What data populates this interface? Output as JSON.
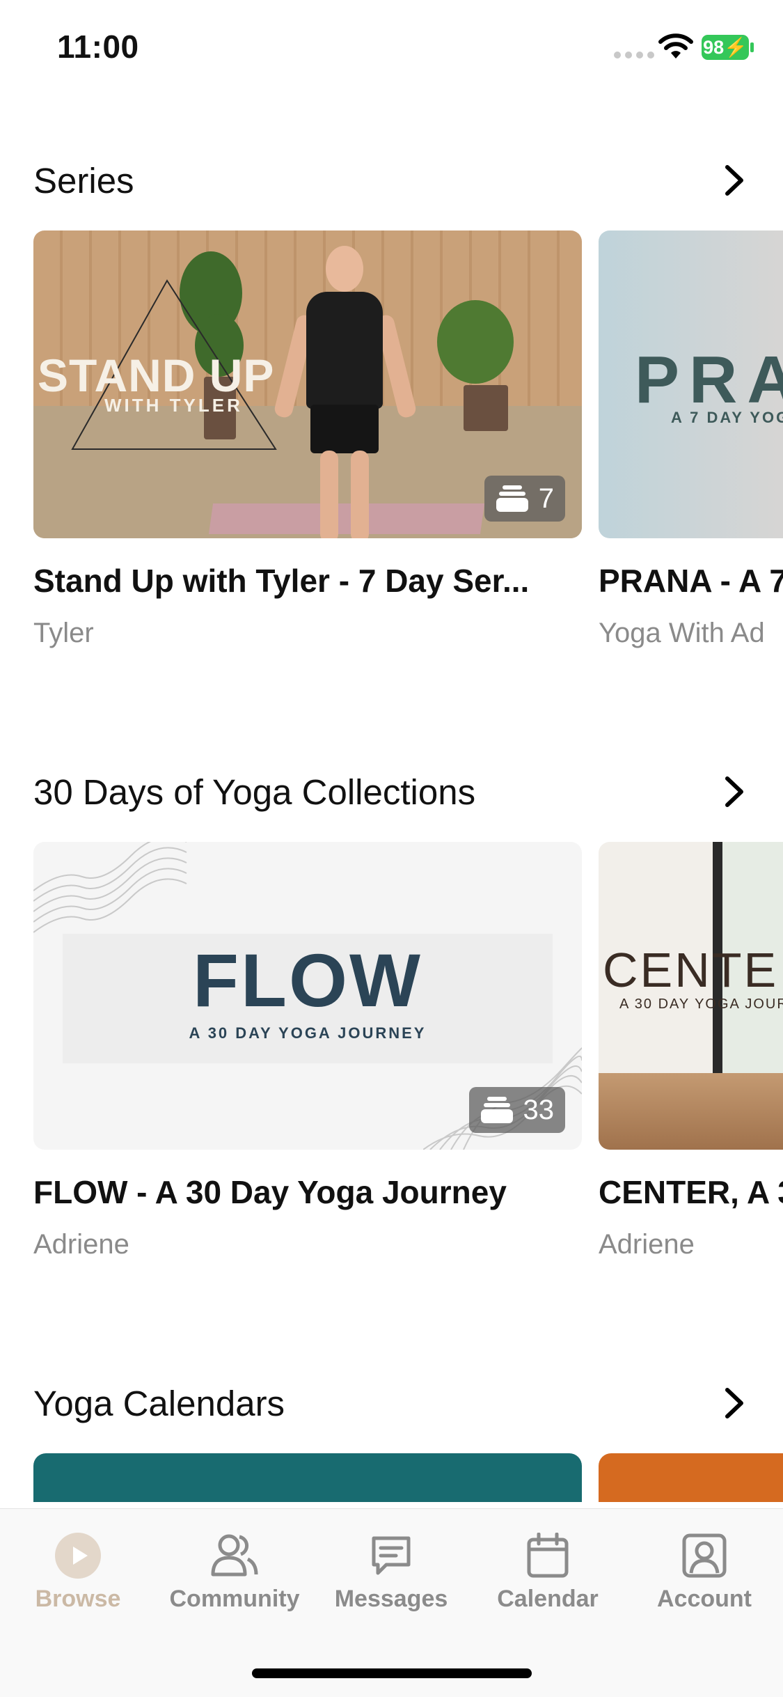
{
  "status_bar": {
    "time": "11:00",
    "battery": "98"
  },
  "sections": [
    {
      "title": "Series",
      "cards": [
        {
          "title": "Stand Up with Tyler - 7 Day Ser...",
          "author": "Tyler",
          "count": "7",
          "thumb_text": "STAND UP",
          "thumb_sub": "WITH TYLER"
        },
        {
          "title": "PRANA - A 7",
          "author": "Yoga With Ad",
          "thumb_text": "PRA",
          "thumb_sub": "A 7 DAY YOG"
        }
      ]
    },
    {
      "title": "30 Days of Yoga Collections",
      "cards": [
        {
          "title": "FLOW - A 30 Day Yoga Journey",
          "author": "Adriene",
          "count": "33",
          "thumb_text": "FLOW",
          "thumb_sub": "A 30 DAY YOGA JOURNEY"
        },
        {
          "title": "CENTER, A 3",
          "author": "Adriene",
          "thumb_text": "CENTE",
          "thumb_sub": "A 30 DAY YOGA JOUR"
        }
      ]
    },
    {
      "title": "Yoga Calendars",
      "cards": []
    }
  ],
  "colors": {
    "calendar_card_1": "#186b70",
    "calendar_card_2": "#d56a20",
    "tab_active": "#cbb9a5",
    "tab_inactive": "#8b8b8b"
  },
  "tab_bar": {
    "tabs": [
      {
        "label": "Browse",
        "icon": "play-circle-icon",
        "active": true
      },
      {
        "label": "Community",
        "icon": "people-icon",
        "active": false
      },
      {
        "label": "Messages",
        "icon": "message-bubble-icon",
        "active": false
      },
      {
        "label": "Calendar",
        "icon": "calendar-icon",
        "active": false
      },
      {
        "label": "Account",
        "icon": "account-icon",
        "active": false
      }
    ]
  }
}
